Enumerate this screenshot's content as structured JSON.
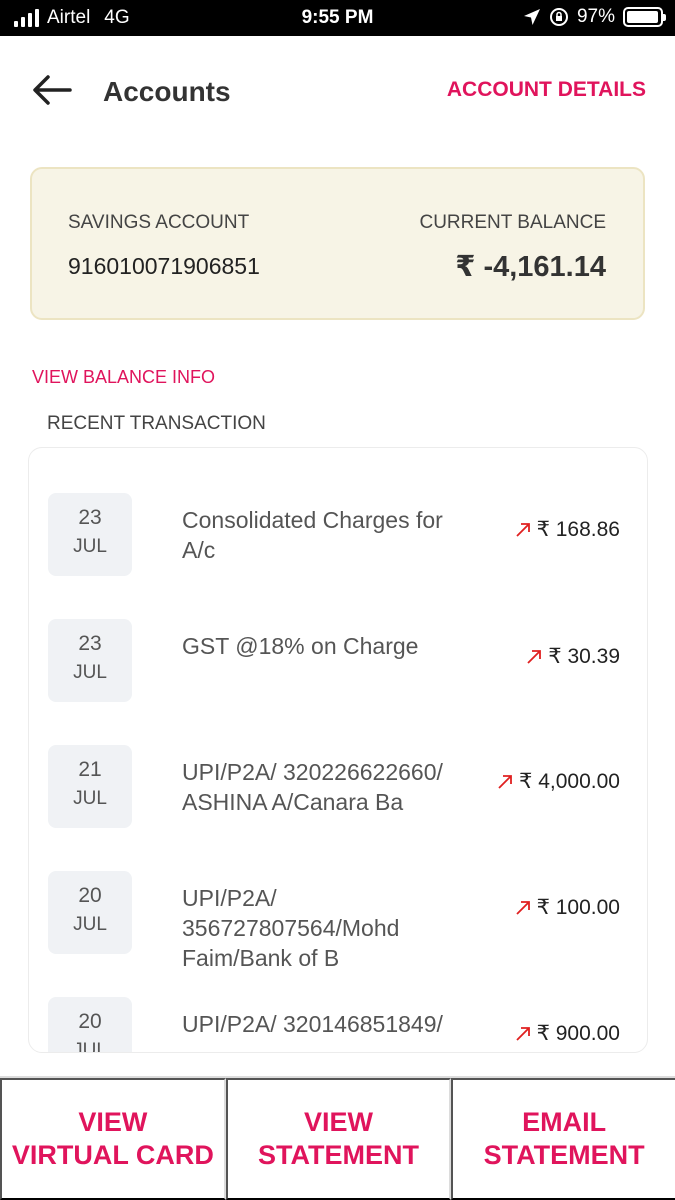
{
  "status_bar": {
    "carrier": "Airtel",
    "network": "4G",
    "time": "9:55 PM",
    "battery": "97%",
    "battery_level": 0.97
  },
  "header": {
    "title": "Accounts",
    "account_details_label": "ACCOUNT DETAILS"
  },
  "account": {
    "type_label": "SAVINGS ACCOUNT",
    "number": "916010071906851",
    "balance_label": "CURRENT BALANCE",
    "balance_value": "₹ -4,161.14"
  },
  "links": {
    "view_balance_info": "VIEW BALANCE INFO"
  },
  "transactions": {
    "title": "RECENT TRANSACTION",
    "items": [
      {
        "day": "23",
        "month": "JUL",
        "description": "Consolidated Charges for A/c",
        "amount": "₹ 168.86"
      },
      {
        "day": "23",
        "month": "JUL",
        "description": "GST @18% on Charge",
        "amount": "₹ 30.39"
      },
      {
        "day": "21",
        "month": "JUL",
        "description": "UPI/P2A/ 320226622660/ ASHINA  A/Canara Ba",
        "amount": "₹ 4,000.00"
      },
      {
        "day": "20",
        "month": "JUL",
        "description": "UPI/P2A/ 356727807564/Mohd Faim/Bank of B",
        "amount": "₹ 100.00"
      },
      {
        "day": "20",
        "month": "JUL",
        "description": "UPI/P2A/ 320146851849/",
        "amount": "₹ 900.00"
      }
    ]
  },
  "bottom_actions": {
    "virtual_card": [
      "VIEW",
      "VIRTUAL CARD"
    ],
    "statement": [
      "VIEW",
      "STATEMENT"
    ],
    "email_statement": [
      "EMAIL",
      "STATEMENT"
    ]
  },
  "colors": {
    "accent": "#e0145c",
    "debit_arrow": "#e02020",
    "card_bg": "#f7f4e6"
  },
  "icons": {
    "back": "arrow-left-icon",
    "debit": "arrow-up-right-icon"
  }
}
